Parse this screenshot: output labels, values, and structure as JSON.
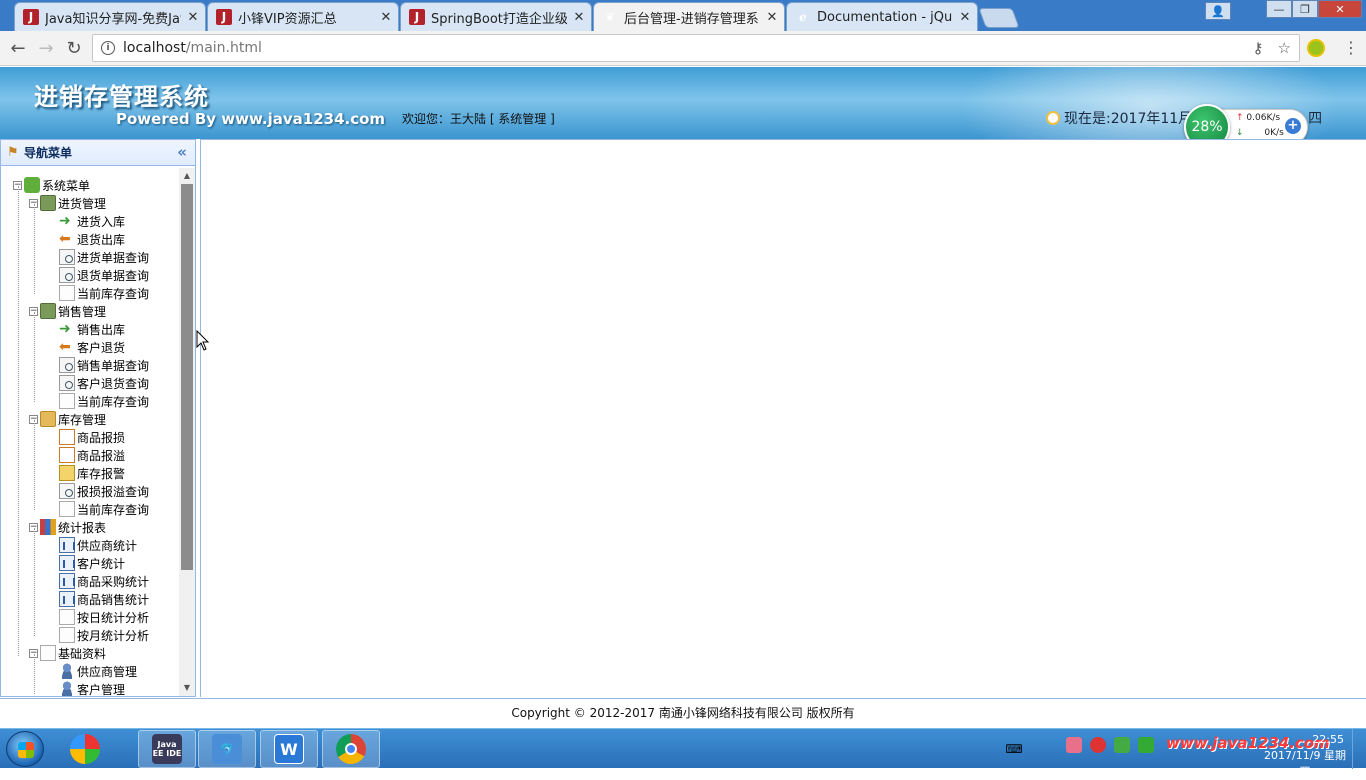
{
  "browser": {
    "tabs": [
      {
        "title": "Java知识分享网-免费Jav",
        "favicon": "java-logo-icon",
        "active": false
      },
      {
        "title": "小锋VIP资源汇总",
        "favicon": "java-logo-icon",
        "active": false
      },
      {
        "title": "SpringBoot打造企业级",
        "favicon": "java-logo-icon",
        "active": false
      },
      {
        "title": "后台管理-进销存管理系",
        "favicon": "leaf-icon",
        "active": true
      },
      {
        "title": "Documentation - jQue",
        "favicon": "easyui-icon",
        "active": false
      }
    ],
    "favicon_letter": "J",
    "close_glyph": "✕",
    "url_host": "localhost",
    "url_path": "/main.html"
  },
  "app": {
    "title": "进销存管理系统",
    "powered_by": "Powered By www.java1234.com",
    "welcome": "欢迎您：王大陆 [ 系统管理 ]",
    "clock": "现在是:2017年11月",
    "clock_suffix": "四"
  },
  "speed_widget": {
    "percent": "28%",
    "up": "0.06K/s",
    "down": "0K/s"
  },
  "nav": {
    "title": "导航菜单",
    "root": "系统菜单",
    "groups": [
      {
        "label": "进货管理",
        "items": [
          "进货入库",
          "退货出库",
          "进货单据查询",
          "退货单据查询",
          "当前库存查询"
        ]
      },
      {
        "label": "销售管理",
        "items": [
          "销售出库",
          "客户退货",
          "销售单据查询",
          "客户退货查询",
          "当前库存查询"
        ]
      },
      {
        "label": "库存管理",
        "items": [
          "商品报损",
          "商品报溢",
          "库存报警",
          "报损报溢查询",
          "当前库存查询"
        ]
      },
      {
        "label": "统计报表",
        "items": [
          "供应商统计",
          "客户统计",
          "商品采购统计",
          "商品销售统计",
          "按日统计分析",
          "按月统计分析"
        ]
      },
      {
        "label": "基础资料",
        "items": [
          "供应商管理",
          "客户管理"
        ]
      }
    ]
  },
  "footer": {
    "copyright": "Copyright © 2012-2017 南通小锋网络科技有限公司 版权所有"
  },
  "taskbar": {
    "watermark": "www.java1234.com",
    "time": "22:55",
    "date": "2017/11/9 星期四",
    "javaee_label": "Java EE IDE"
  },
  "colors": {
    "header_blue": "#3f9dd6",
    "panel_border": "#95b8e7",
    "taskbar_blue": "#2a6fb8"
  }
}
